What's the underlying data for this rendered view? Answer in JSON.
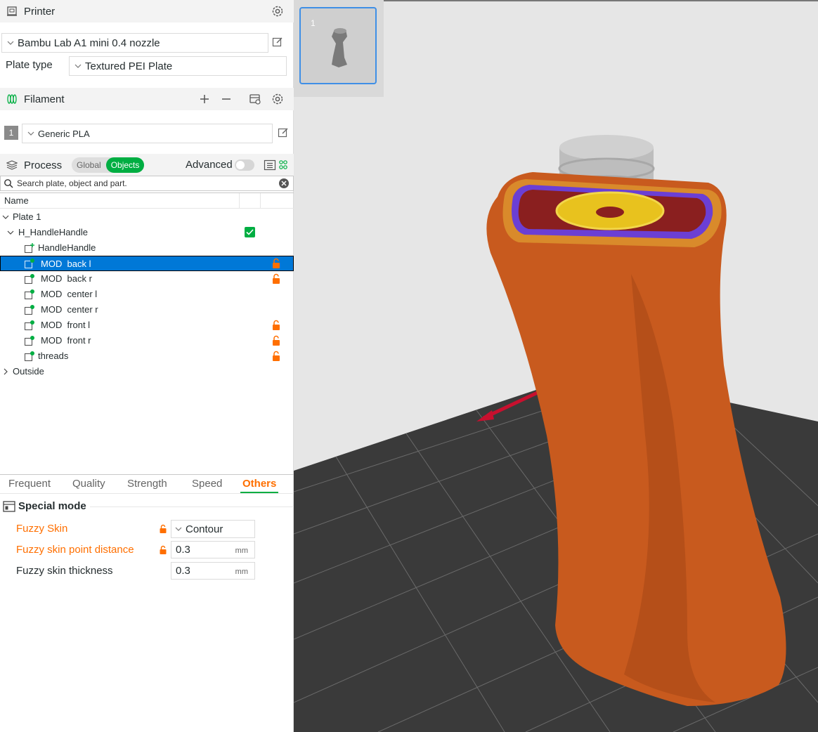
{
  "printer": {
    "title": "Printer",
    "preset": "Bambu Lab A1 mini 0.4 nozzle",
    "plate_type_label": "Plate type",
    "plate_type": "Textured PEI Plate"
  },
  "filament": {
    "title": "Filament",
    "slots": [
      {
        "index": "1",
        "name": "Generic PLA"
      }
    ]
  },
  "process": {
    "title": "Process",
    "mode_global": "Global",
    "mode_objects": "Objects",
    "advanced_label": "Advanced",
    "search_placeholder": "Search plate, object and part."
  },
  "object_list": {
    "name_header": "Name",
    "plate": "Plate 1",
    "object": "H_HandleHandle",
    "parts": [
      {
        "label": "HandleHandle"
      },
      {
        "label": "MOD  back l"
      },
      {
        "label": "MOD  back r"
      },
      {
        "label": "MOD  center l"
      },
      {
        "label": "MOD  center r"
      },
      {
        "label": "MOD  front l"
      },
      {
        "label": "MOD  front r"
      },
      {
        "label": "threads"
      }
    ],
    "outside": "Outside"
  },
  "settings_tabs": [
    "Frequent",
    "Quality",
    "Strength",
    "Speed",
    "Others"
  ],
  "special_mode": {
    "title": "Special mode",
    "params": [
      {
        "label": "Fuzzy Skin",
        "value": "Contour"
      },
      {
        "label": "Fuzzy skin point distance",
        "value": "0.3",
        "unit": "mm"
      },
      {
        "label": "Fuzzy skin thickness",
        "value": "0.3",
        "unit": "mm"
      }
    ]
  },
  "viewport": {
    "plate_thumbnail_number": "1"
  },
  "colors": {
    "accent_green": "#00ae42",
    "modified_orange": "#ff6f00",
    "selection_blue": "#0078d7",
    "model_orange": "#c85a1e",
    "bed_dark": "#3a3a3a"
  }
}
